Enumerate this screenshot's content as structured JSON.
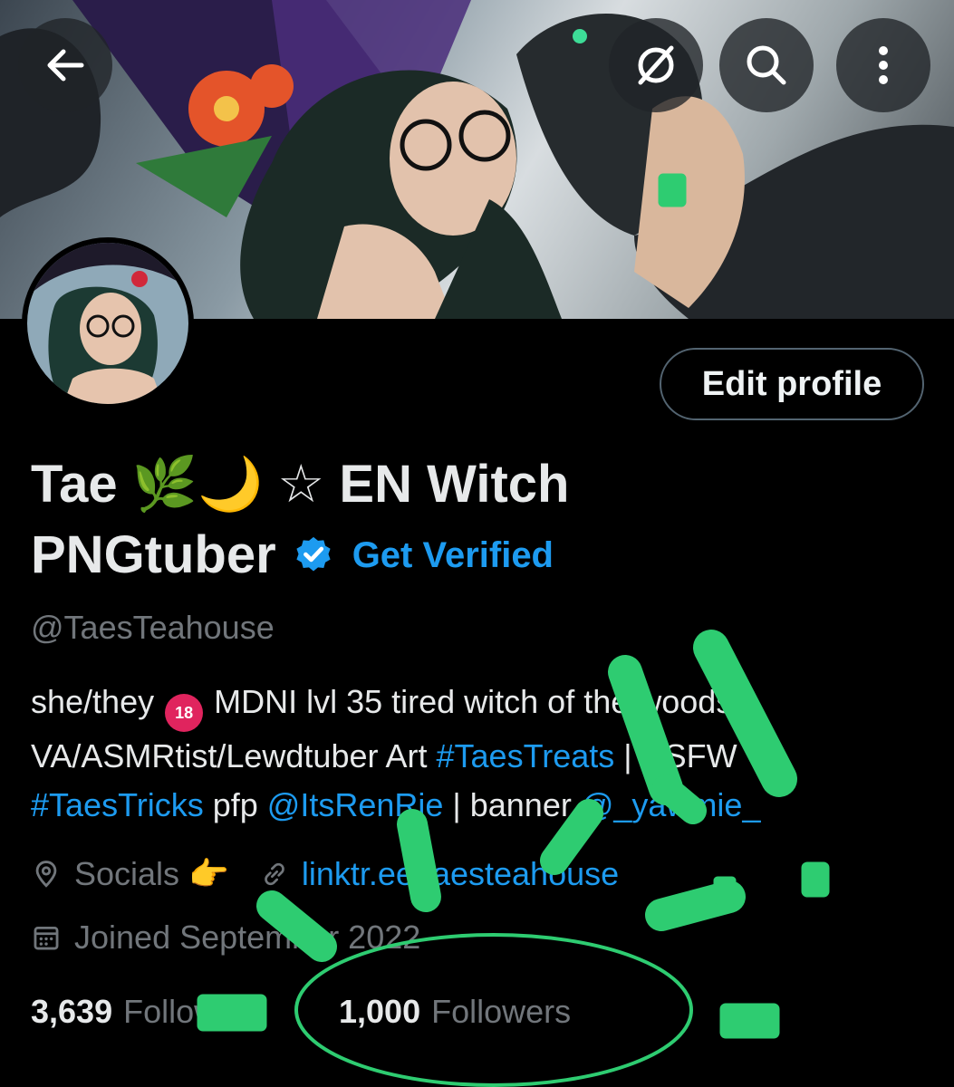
{
  "header": {
    "back_icon": "arrow-left-icon",
    "grok_icon": "grok-slash-circle-icon",
    "search_icon": "search-icon",
    "more_icon": "more-vertical-icon"
  },
  "profile": {
    "edit_button_label": "Edit profile",
    "name_line1": "Tae 🌿🌙 ☆ EN Witch",
    "name_line2": "PNGtuber",
    "get_verified_label": "Get Verified",
    "handle": "@TaesTeahouse",
    "bio": {
      "line1_a": "she/they ",
      "mdni_badge": "18",
      "line1_b": " MDNI lvl 35 tired witch of the woods",
      "line2_a": "VA/ASMRtist/Lewdtuber  Art ",
      "line2_tag": "#TaesTreats",
      "line2_b": " | NSFW",
      "line3_tag": "#TaesTricks",
      "line3_a": "  pfp ",
      "line3_mention": "@ItsRenRie",
      "line3_b": " | banner ",
      "line3_mention2": "@_yawmie_"
    },
    "location": "Socials 👉",
    "website": "linktr.ee/taesteahouse",
    "joined": "Joined September 2022"
  },
  "stats": {
    "following_count": "3,639",
    "following_label": "Following",
    "followers_count": "1,000",
    "followers_label": "Followers"
  },
  "colors": {
    "accent": "#1d9bf0",
    "scribble": "#2ecc71"
  }
}
